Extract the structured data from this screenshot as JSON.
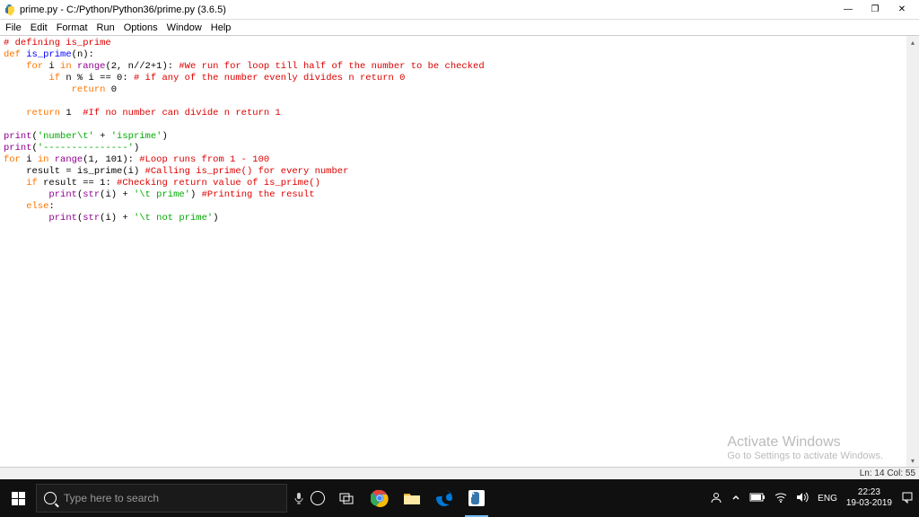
{
  "window": {
    "title": "prime.py - C:/Python/Python36/prime.py (3.6.5)",
    "minimize": "—",
    "maximize": "❐",
    "close": "✕"
  },
  "menu": {
    "file": "File",
    "edit": "Edit",
    "format": "Format",
    "run": "Run",
    "options": "Options",
    "window": "Window",
    "help": "Help"
  },
  "code": {
    "l1_comment": "# defining is_prime",
    "l2_def": "def ",
    "l2_name": "is_prime",
    "l2_paren": "(n):",
    "l3_indent": "    ",
    "l3_for": "for",
    "l3_mid": " i ",
    "l3_in": "in",
    "l3_range": " range",
    "l3_args": "(2, n//2+1): ",
    "l3_comment": "#We run for loop till half of the number to be checked",
    "l4_indent": "        ",
    "l4_if": "if",
    "l4_cond": " n % i == 0: ",
    "l4_comment": "# if any of the number evenly divides n return 0",
    "l5_indent": "            ",
    "l5_return": "return",
    "l5_val": " 0",
    "l6": "",
    "l7_indent": "    ",
    "l7_return": "return",
    "l7_val": " 1  ",
    "l7_comment": "#If no number can divide n return 1",
    "l8": "",
    "l9_print": "print",
    "l9_paren": "(",
    "l9_str1": "'number\\t'",
    "l9_plus": " + ",
    "l9_str2": "'isprime'",
    "l9_close": ")",
    "l10_print": "print",
    "l10_paren": "(",
    "l10_str": "'---------------'",
    "l10_close": ")",
    "l11_for": "for",
    "l11_mid": " i ",
    "l11_in": "in",
    "l11_range": " range",
    "l11_args": "(1, 101): ",
    "l11_comment": "#Loop runs from 1 - 100",
    "l12_indent": "    ",
    "l12_text": "result = is_prime(i) ",
    "l12_comment": "#Calling is_prime() for every number",
    "l13_indent": "    ",
    "l13_if": "if",
    "l13_cond": " result == 1: ",
    "l13_comment": "#Checking return value of is_prime()",
    "l14_indent": "        ",
    "l14_print": "print",
    "l14_open": "(",
    "l14_str": "str",
    "l14_args": "(i) + ",
    "l14_str2": "'\\t prime'",
    "l14_close": ") ",
    "l14_comment": "#Printing the result",
    "l15_indent": "    ",
    "l15_else": "else",
    "l15_colon": ":",
    "l16_indent": "        ",
    "l16_print": "print",
    "l16_open": "(",
    "l16_str": "str",
    "l16_args": "(i) + ",
    "l16_str2": "'\\t not prime'",
    "l16_close": ")"
  },
  "watermark": {
    "title": "Activate Windows",
    "sub": "Go to Settings to activate Windows."
  },
  "statusbar": {
    "text": "Ln: 14  Col: 55"
  },
  "taskbar": {
    "search_placeholder": "Type here to search",
    "lang": "ENG",
    "time": "22:23",
    "date": "19-03-2019"
  }
}
